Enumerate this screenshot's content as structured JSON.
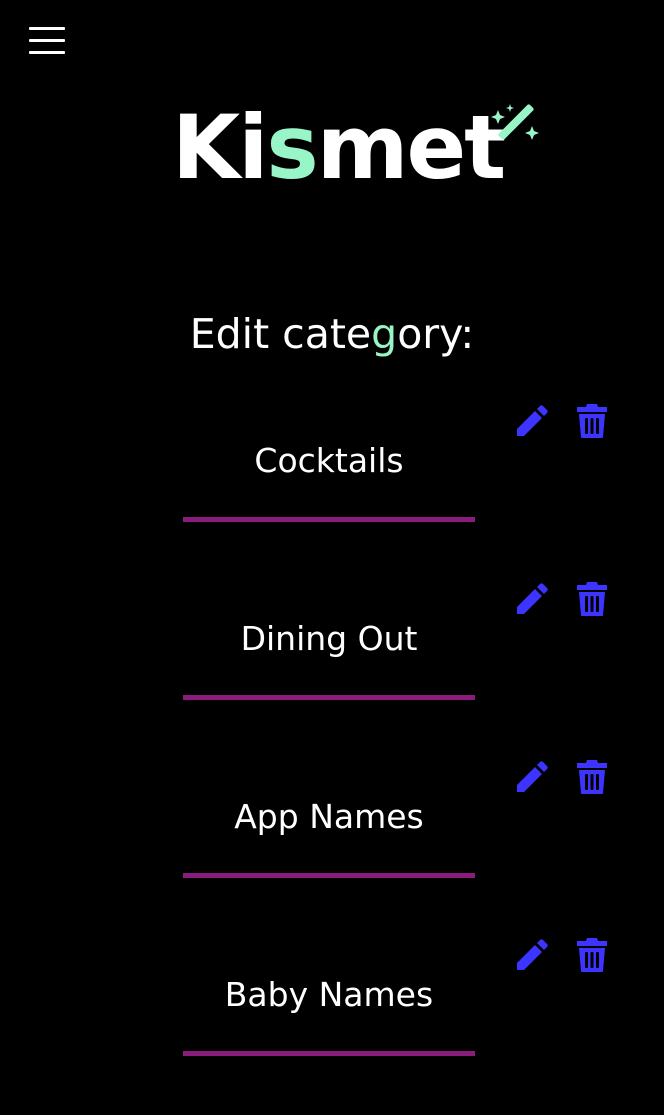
{
  "app": {
    "logo_prefix": "Ki",
    "logo_accent": "s",
    "logo_suffix": "met",
    "logo_icon": "magic-wand-icon"
  },
  "nav": {
    "menu_icon": "hamburger-menu-icon"
  },
  "heading": {
    "part1": "Edit cate",
    "accent": "g",
    "part2": "ory:"
  },
  "categories": [
    {
      "label": "Cocktails"
    },
    {
      "label": "Dining Out"
    },
    {
      "label": "App Names"
    },
    {
      "label": "Baby Names"
    }
  ],
  "colors": {
    "background": "#000000",
    "accent": "#98f5c8",
    "icon": "#3d35ff",
    "underline": "#8a1c7c"
  }
}
